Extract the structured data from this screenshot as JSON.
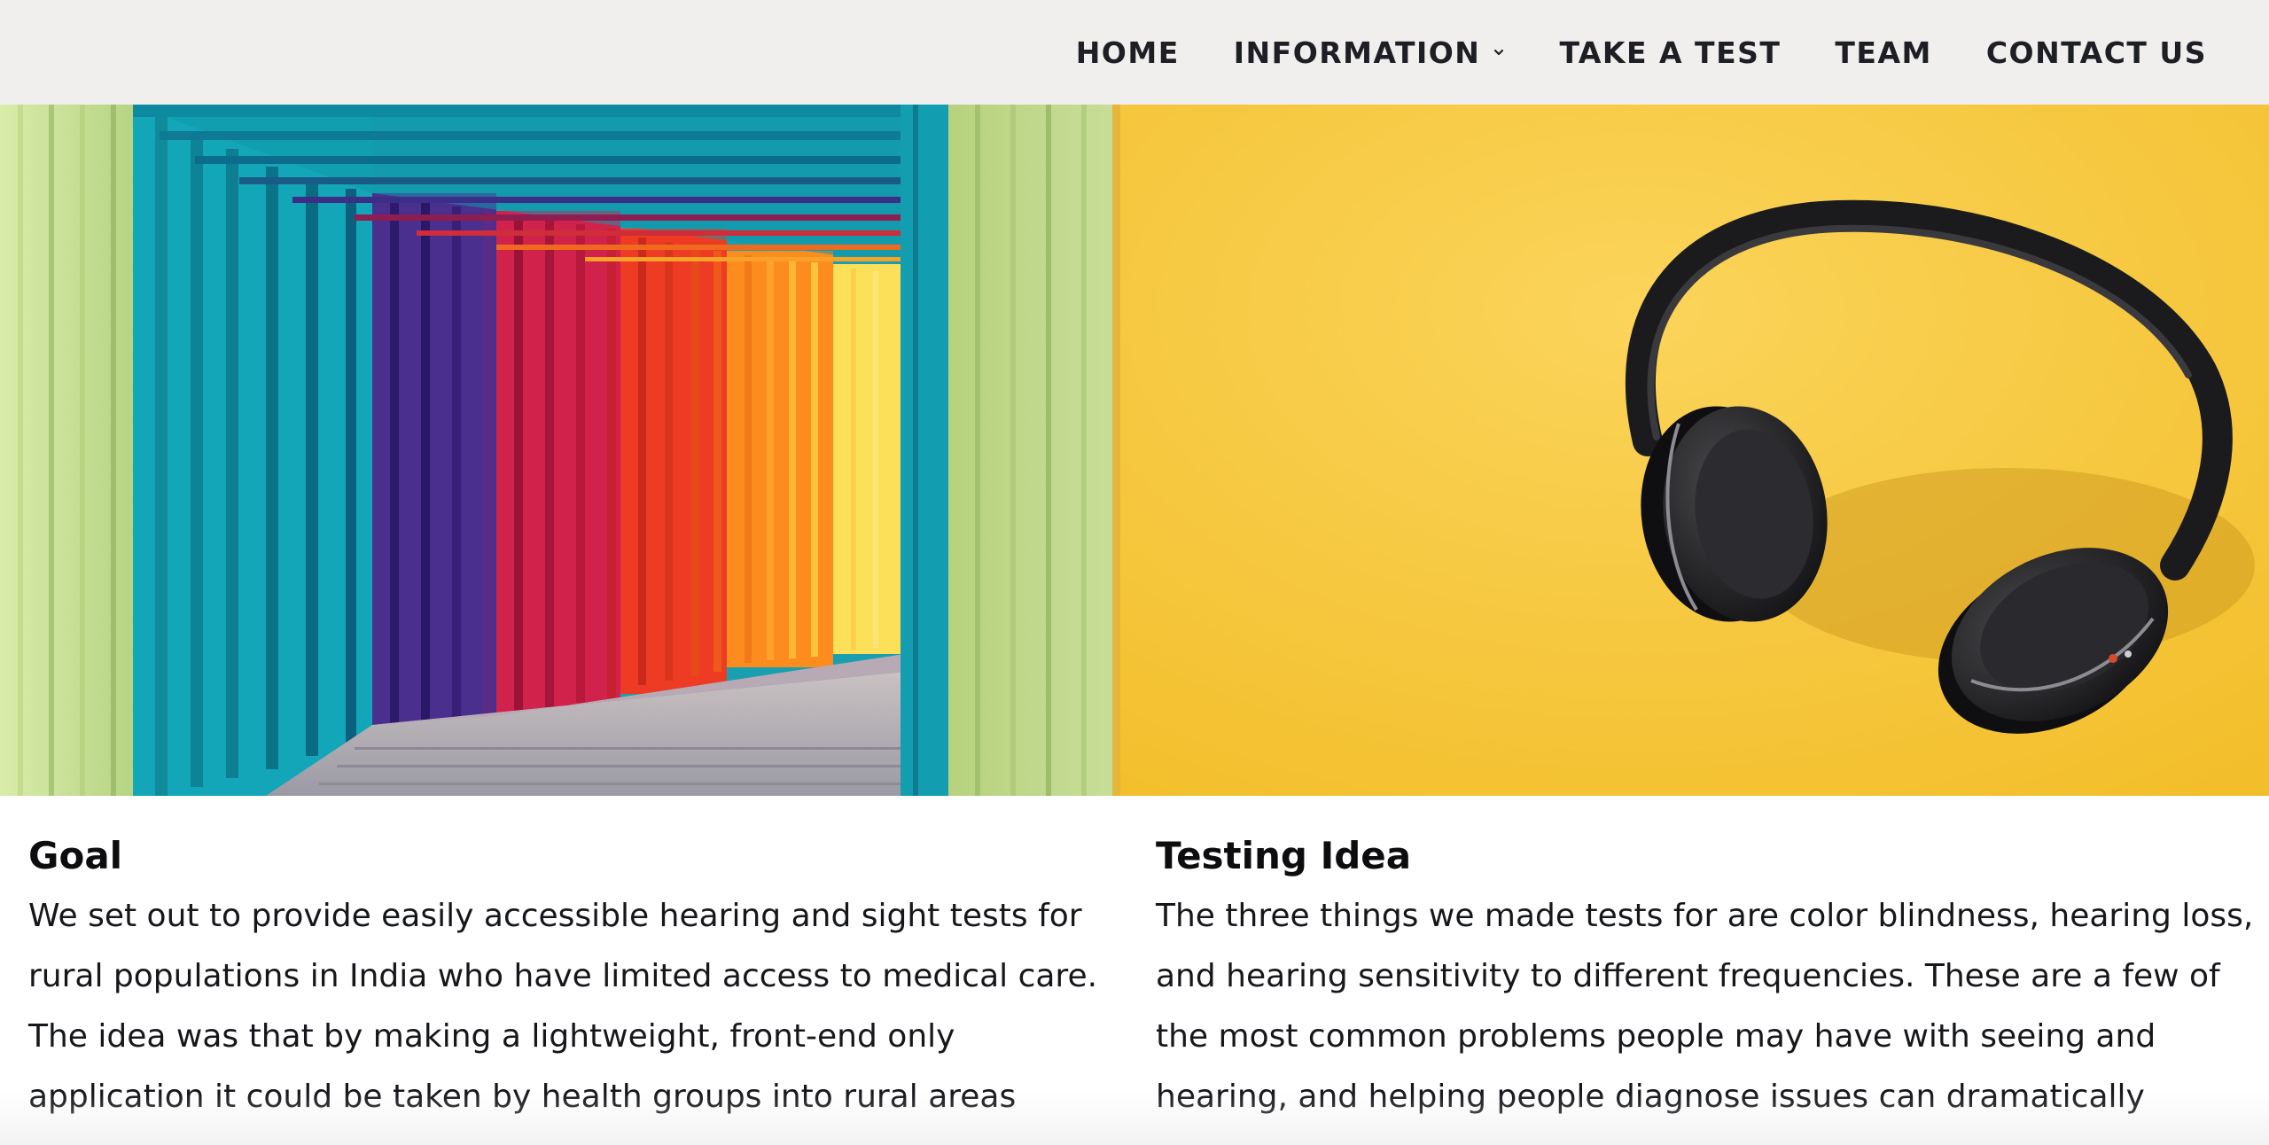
{
  "nav": {
    "items": [
      {
        "label": "HOME"
      },
      {
        "label": "INFORMATION",
        "has_dropdown": true
      },
      {
        "label": "TAKE A TEST"
      },
      {
        "label": "TEAM"
      },
      {
        "label": "CONTACT US"
      }
    ]
  },
  "sections": {
    "goal": {
      "title": "Goal",
      "lines": [
        "We set out to provide easily accessible hearing and sight tests for",
        "rural populations in India who have limited access to medical care.",
        "The idea was that by making a lightweight, front-end only",
        "application it could be taken by health groups into rural areas"
      ]
    },
    "testing_idea": {
      "title": "Testing Idea",
      "lines": [
        "The three things we made tests for are color blindness, hearing loss,",
        "and hearing sensitivity to different frequencies. These are a few of",
        "the most common problems people may have with seeing and",
        "hearing, and helping people diagnose issues can dramatically"
      ]
    }
  },
  "images": {
    "left": "rainbow-tunnel-image",
    "right": "headphones-on-yellow-image"
  },
  "colors": {
    "nav_bg": "#f0efed",
    "nav_text": "#1e1f24",
    "yellow_bg": "#f7c630"
  }
}
